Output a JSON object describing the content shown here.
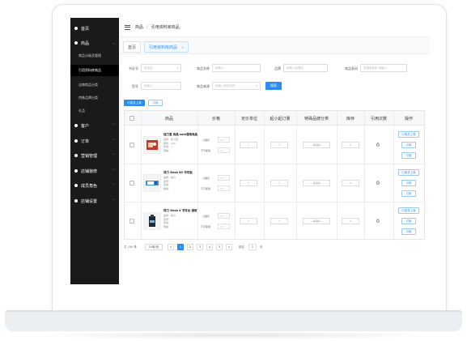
{
  "sidebar": {
    "items": [
      {
        "label": "首页"
      },
      {
        "label": "商品"
      },
      {
        "label": "客户"
      },
      {
        "label": "订单"
      },
      {
        "label": "营销管理"
      },
      {
        "label": "店铺装修"
      },
      {
        "label": "成员角色"
      },
      {
        "label": "店铺设置"
      }
    ],
    "sub_items": [
      {
        "label": "商品分级及管理"
      },
      {
        "label": "引用资料库商品"
      },
      {
        "label": "店铺商品分类"
      },
      {
        "label": "特殊品牌分类"
      },
      {
        "label": "礼品"
      }
    ]
  },
  "topbar": {
    "crumb1": "商品",
    "crumb_sep": "/",
    "crumb2": "引用资料库商品"
  },
  "tabs": {
    "home": "首页",
    "current": "引用资料库商品",
    "close": "×"
  },
  "filters": {
    "label1": "书证号",
    "input1": "请选择",
    "label2": "商品名称",
    "input2": "请输入",
    "label3": "品牌",
    "input3": "请输入品牌名",
    "label4": "商品条码",
    "input4": "请搜索条码 请输入",
    "label5": "型号",
    "input5": "请输入",
    "label6": "商品来源",
    "input6": "请输入类型名称",
    "search": "搜索"
  },
  "actions": {
    "batch": "引用并上架",
    "ref": "引用"
  },
  "table": {
    "headers": [
      "商品",
      "价格",
      "定价单位",
      "起小起订量",
      "特殊品牌分类",
      "库存",
      "引用次数",
      "操作"
    ],
    "rows": [
      {
        "name": "佳力宝 商品 sale通用商品",
        "meta": [
          "品牌：佳力宝",
          "型号：L20",
          "条码：—",
          "规格："
        ],
        "price_label1": "小程序",
        "price_input1": "0.0",
        "price_label2": "不可使用",
        "price_input2": "0.0",
        "unit": "个",
        "moq": "个",
        "special": "—特品牌—",
        "stock": "0",
        "count": "0",
        "op1": "引用并上架",
        "op2": "引用",
        "op3": "引用"
      },
      {
        "name": "得力 Desk 80 书写板",
        "meta": [
          "品牌：得力",
          "型号：",
          "条码：",
          "规格："
        ],
        "price_label1": "小程序",
        "price_input1": "0.0",
        "price_label2": "不可使用",
        "price_input2": "0.0",
        "unit": "个",
        "moq": "个",
        "special": "—特品牌—",
        "stock": "0",
        "count": "0",
        "op1": "引用并上架",
        "op2": "引用",
        "op3": "引用"
      },
      {
        "name": "得力 Desk 4 书写台 通用",
        "meta": [
          "品牌：得力",
          "型号：",
          "条码：",
          "规格："
        ],
        "price_label1": "小程序",
        "price_input1": "0.0",
        "price_label2": "不可使用",
        "price_input2": "0.0",
        "unit": "个",
        "moq": "个",
        "special": "—特品牌—",
        "stock": "0",
        "count": "0",
        "op1": "引用并上架",
        "op2": "引用",
        "op3": "引用"
      }
    ]
  },
  "pagination": {
    "total": "共 100 条",
    "per_page": "20条/页",
    "prev": "<",
    "pages": [
      "1",
      "2",
      "3",
      "4",
      "5"
    ],
    "next": ">",
    "goto_label": "前往",
    "goto_value": "1",
    "goto_suffix": "页"
  },
  "colors": {
    "accent": "#2b8cf5",
    "sidebar": "#1a1a1a"
  }
}
